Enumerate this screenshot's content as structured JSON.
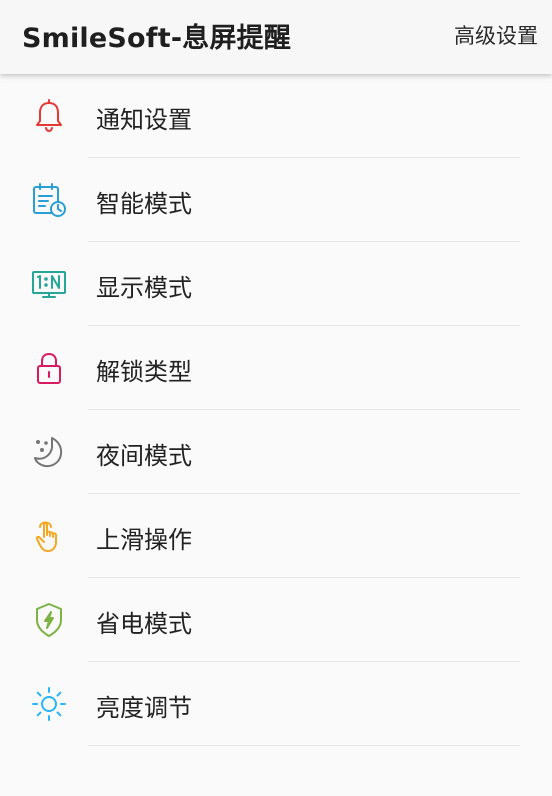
{
  "appbar": {
    "title": "SmileSoft-息屏提醒",
    "action_label": "高级设置"
  },
  "menu": {
    "items": [
      {
        "label": "通知设置",
        "icon": "bell-icon",
        "color": "#e53935"
      },
      {
        "label": "智能模式",
        "icon": "calendar-clock-icon",
        "color": "#2a9fd6"
      },
      {
        "label": "显示模式",
        "icon": "ratio-display-icon",
        "color": "#26a69a"
      },
      {
        "label": "解锁类型",
        "icon": "lock-icon",
        "color": "#d81b60"
      },
      {
        "label": "夜间模式",
        "icon": "moon-icon",
        "color": "#757575"
      },
      {
        "label": "上滑操作",
        "icon": "hand-swipe-icon",
        "color": "#f5a623"
      },
      {
        "label": "省电模式",
        "icon": "battery-shield-icon",
        "color": "#7cb342"
      },
      {
        "label": "亮度调节",
        "icon": "sun-icon",
        "color": "#29b6f6"
      }
    ]
  }
}
